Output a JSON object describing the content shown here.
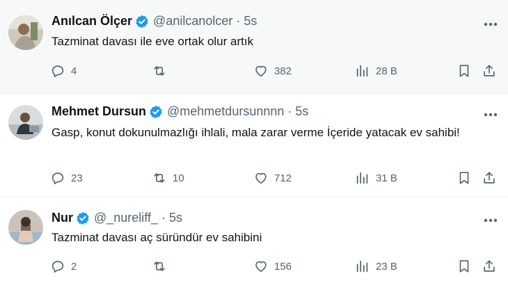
{
  "colors": {
    "text": "#0f1419",
    "muted": "#536471",
    "verified": "#1d9bf0",
    "highlight_bg": "#f7f9f9",
    "divider": "#eff3f4"
  },
  "icons": {
    "verified": "verified-badge-icon",
    "more": "more-icon",
    "reply": "reply-icon",
    "retweet": "retweet-icon",
    "like": "heart-icon",
    "views": "views-icon",
    "bookmark": "bookmark-icon",
    "share": "share-icon"
  },
  "tweets": [
    {
      "name": "Anılcan Ölçer",
      "handle": "@anilcanolcer",
      "separator": "·",
      "time": "5s",
      "text": "Tazminat davası ile eve ortak olur artık",
      "replies": "4",
      "retweets": "",
      "likes": "382",
      "views": "28 B"
    },
    {
      "name": "Mehmet Dursun",
      "handle": "@mehmetdursunnnn",
      "separator": "·",
      "time": "5s",
      "text": "Gasp, konut dokunulmazlığı ihlali, mala zarar verme İçeride yatacak  ev sahibi!",
      "replies": "23",
      "retweets": "10",
      "likes": "712",
      "views": "31 B"
    },
    {
      "name": "Nur",
      "handle": "@_nureliff_",
      "separator": "·",
      "time": "5s",
      "text": "Tazminat davası aç süründür ev sahibini",
      "replies": "2",
      "retweets": "",
      "likes": "156",
      "views": "23 B"
    }
  ]
}
